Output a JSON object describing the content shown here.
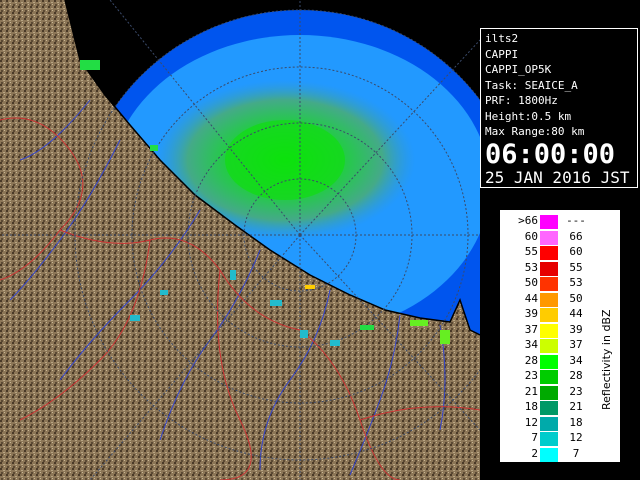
{
  "info": {
    "station": "ilts2",
    "product": "CAPPI",
    "product_code": "CAPPI_OP5K",
    "task": "Task: SEAICE_A",
    "prf": "PRF: 1800Hz",
    "height": "Height:0.5 km",
    "max_range": "Max Range:80 km",
    "time": "06:00:00",
    "date": "25 JAN 2016 JST"
  },
  "legend": {
    "title": "Reflectivity in dBZ",
    "rows": [
      {
        "lo": ">66",
        "hi": "---",
        "color": "#ff00ff"
      },
      {
        "lo": "60",
        "hi": "66",
        "color": "#ff66ff"
      },
      {
        "lo": "55",
        "hi": "60",
        "color": "#ff0000"
      },
      {
        "lo": "53",
        "hi": "55",
        "color": "#e60000"
      },
      {
        "lo": "50",
        "hi": "53",
        "color": "#ff3300"
      },
      {
        "lo": "44",
        "hi": "50",
        "color": "#ff9900"
      },
      {
        "lo": "39",
        "hi": "44",
        "color": "#ffcc00"
      },
      {
        "lo": "37",
        "hi": "39",
        "color": "#ffff00"
      },
      {
        "lo": "34",
        "hi": "37",
        "color": "#ccff00"
      },
      {
        "lo": "28",
        "hi": "34",
        "color": "#00ff00"
      },
      {
        "lo": "23",
        "hi": "28",
        "color": "#00cc00"
      },
      {
        "lo": "21",
        "hi": "23",
        "color": "#00aa00"
      },
      {
        "lo": "18",
        "hi": "21",
        "color": "#009966"
      },
      {
        "lo": "12",
        "hi": "18",
        "color": "#00aaaa"
      },
      {
        "lo": "7",
        "hi": "12",
        "color": "#00cccc"
      },
      {
        "lo": "2",
        "hi": "7",
        "color": "#00ffff"
      }
    ]
  },
  "colors": {
    "radar_range": "#0055ee",
    "light_echo": "#2299ff",
    "land": "#8c7657",
    "coast": "#000000",
    "rivers": "#3344cc",
    "borders": "#cc3333"
  }
}
